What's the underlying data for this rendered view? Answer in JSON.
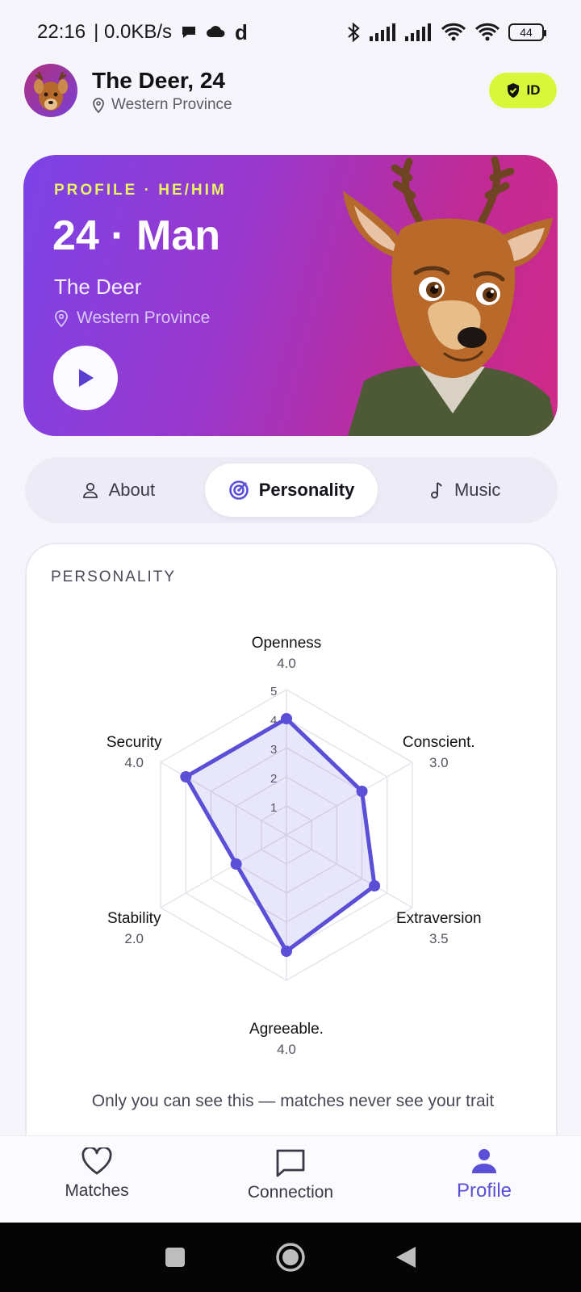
{
  "status_bar": {
    "time": "22:16",
    "net_speed": "| 0.0KB/s",
    "battery": "44",
    "icons": [
      "chat-bubble-icon",
      "cloud-icon",
      "d-app-icon",
      "bluetooth-icon",
      "signal-icon",
      "signal-icon",
      "wifi-icon",
      "wifi-icon",
      "battery-icon"
    ]
  },
  "header": {
    "name": "The Deer, 24",
    "location": "Western Province",
    "badge": "ID",
    "badge_color": "#d8f63a"
  },
  "hero": {
    "eyebrow": "PROFILE · HE/HIM",
    "title": "24 · Man",
    "name": "The Deer",
    "location": "Western Province",
    "gradient": [
      "#7c43e6",
      "#cf2a88"
    ]
  },
  "tabs": [
    {
      "label": "About",
      "icon": "person-icon",
      "active": false
    },
    {
      "label": "Personality",
      "icon": "radar-icon",
      "active": true
    },
    {
      "label": "Music",
      "icon": "music-note-icon",
      "active": false
    }
  ],
  "personality": {
    "title": "PERSONALITY",
    "note": "Only you can see this — matches never see your trait"
  },
  "chart_data": {
    "type": "radar",
    "title": "",
    "scale": [
      1,
      2,
      3,
      4,
      5
    ],
    "rmax": 5,
    "accent": "#5b4fd8",
    "axes": [
      {
        "label": "Openness",
        "value": 4.0,
        "value_text": "4.0"
      },
      {
        "label": "Conscient.",
        "value": 3.0,
        "value_text": "3.0"
      },
      {
        "label": "Extraversion",
        "value": 3.5,
        "value_text": "3.5"
      },
      {
        "label": "Agreeable.",
        "value": 4.0,
        "value_text": "4.0"
      },
      {
        "label": "Stability",
        "value": 2.0,
        "value_text": "2.0"
      },
      {
        "label": "Security",
        "value": 4.0,
        "value_text": "4.0"
      }
    ]
  },
  "bottom_nav": [
    {
      "label": "Matches",
      "icon": "heart-icon",
      "active": false
    },
    {
      "label": "Connection",
      "icon": "chat-icon",
      "active": false
    },
    {
      "label": "Profile",
      "icon": "person-icon",
      "active": true
    }
  ],
  "colors": {
    "accent": "#5a4fd6",
    "background": "#f6f5fb"
  }
}
